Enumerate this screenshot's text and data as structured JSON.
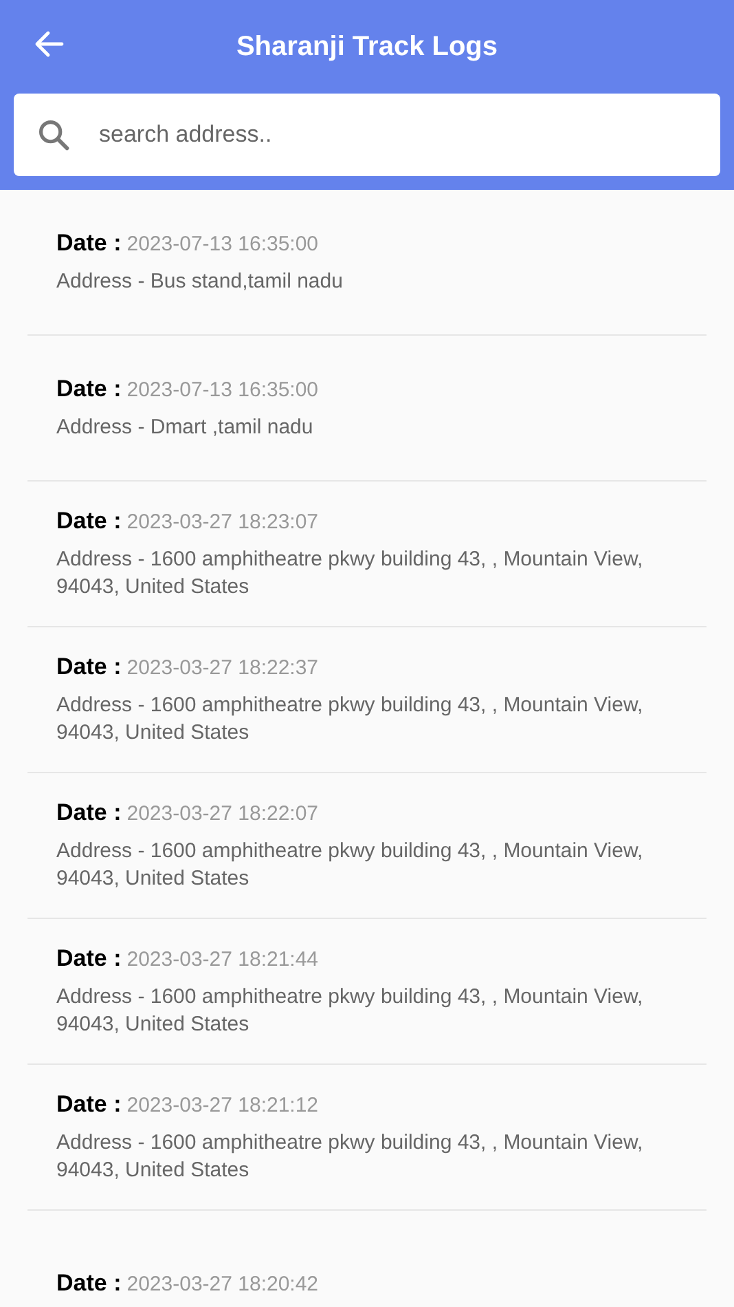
{
  "header": {
    "title": "Sharanji Track Logs"
  },
  "search": {
    "placeholder": "search address.."
  },
  "logs": [
    {
      "date_label": "Date :",
      "date": "2023-07-13 16:35:00",
      "address": "Address - Bus stand,tamil nadu"
    },
    {
      "date_label": "Date :",
      "date": "2023-07-13 16:35:00",
      "address": "Address - Dmart ,tamil nadu"
    },
    {
      "date_label": "Date :",
      "date": "2023-03-27 18:23:07",
      "address": "Address - 1600 amphitheatre pkwy building 43, , Mountain View, 94043, United States"
    },
    {
      "date_label": "Date :",
      "date": "2023-03-27 18:22:37",
      "address": "Address - 1600 amphitheatre pkwy building 43, , Mountain View, 94043, United States"
    },
    {
      "date_label": "Date :",
      "date": "2023-03-27 18:22:07",
      "address": "Address - 1600 amphitheatre pkwy building 43, , Mountain View, 94043, United States"
    },
    {
      "date_label": "Date :",
      "date": "2023-03-27 18:21:44",
      "address": "Address - 1600 amphitheatre pkwy building 43, , Mountain View, 94043, United States"
    },
    {
      "date_label": "Date :",
      "date": "2023-03-27 18:21:12",
      "address": "Address - 1600 amphitheatre pkwy building 43, , Mountain View, 94043, United States"
    },
    {
      "date_label": "Date :",
      "date": "2023-03-27 18:20:42"
    }
  ]
}
